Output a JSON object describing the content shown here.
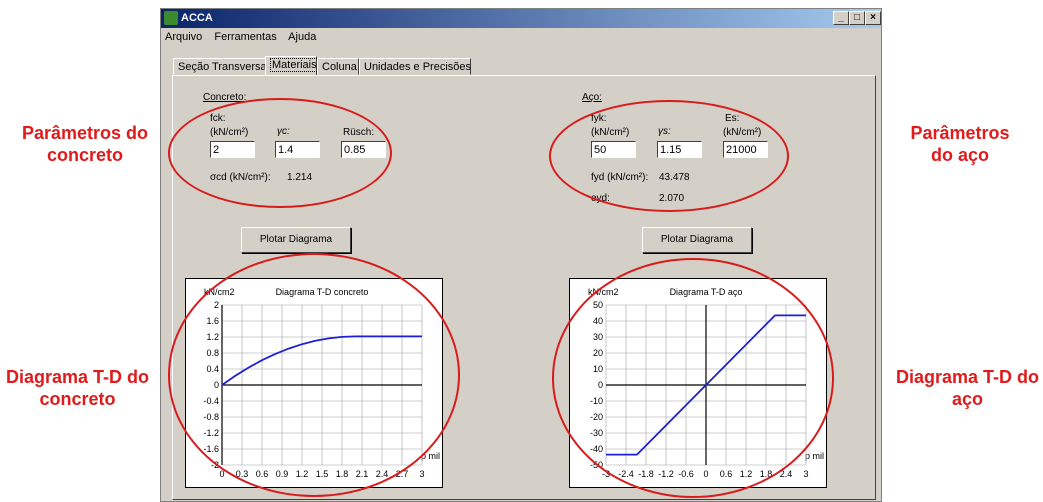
{
  "window": {
    "title": "ACCA"
  },
  "menu": [
    "Arquivo",
    "Ferramentas",
    "Ajuda"
  ],
  "tabs": [
    "Seção Transversal",
    "Materiais",
    "Coluna",
    "Unidades e Precisões"
  ],
  "active_tab": "Materiais",
  "concrete": {
    "section_label": "Concreto:",
    "fck_label": "fck:",
    "fck_unit": "(kN/cm²)",
    "fck_value": "2",
    "gamma_label": "γc:",
    "gamma_value": "1.4",
    "rusch_label": "Rüsch:",
    "rusch_value": "0.85",
    "sigma_label": "σcd (kN/cm²):",
    "sigma_value": "1.214",
    "plot_button": "Plotar Diagrama"
  },
  "steel": {
    "section_label": "Aço:",
    "fyk_label": "fyk:",
    "fyk_unit": "(kN/cm²)",
    "fyk_value": "50",
    "gamma_label": "γs:",
    "gamma_value": "1.15",
    "es_label": "Es:",
    "es_unit": "(kN/cm²)",
    "es_value": "21000",
    "fyd_label": "fyd (kN/cm²):",
    "fyd_value": "43.478",
    "eyd_label": "eyd:",
    "eyd_value": "2.070",
    "plot_button": "Plotar Diagrama"
  },
  "annotations": {
    "concrete_params": "Parâmetros do concreto",
    "steel_params": "Parâmetros do aço",
    "concrete_diagram": "Diagrama T-D do concreto",
    "steel_diagram": "Diagrama T-D do aço"
  },
  "colors": {
    "annotation": "#e01b1b",
    "curve": "#1f1fd6",
    "title_bar": "#0a246a"
  },
  "chart_data": [
    {
      "type": "line",
      "title": "Diagrama T-D concreto",
      "ylabel": "kN/cm2",
      "xlabel": "p mil",
      "xlim": [
        0,
        3
      ],
      "ylim": [
        -2,
        2
      ],
      "xticks": [
        "0",
        "0.3",
        "0.6",
        "0.9",
        "1.2",
        "1.5",
        "1.8",
        "2.1",
        "2.4",
        "2.7",
        "3"
      ],
      "yticks": [
        "2",
        "1.6",
        "1.2",
        "0.8",
        "0.4",
        "0",
        "-0.4",
        "-0.8",
        "-1.2",
        "-1.6",
        "-2"
      ],
      "grid": true,
      "series": [
        {
          "x": [
            0,
            0.2,
            0.4,
            0.6,
            0.8,
            1.0,
            1.2,
            1.4,
            1.6,
            1.8,
            2.0,
            2.2,
            2.4,
            2.6,
            2.8,
            3.0
          ],
          "y": [
            0,
            0.231,
            0.437,
            0.619,
            0.777,
            0.911,
            1.02,
            1.105,
            1.166,
            1.202,
            1.214,
            1.214,
            1.214,
            1.214,
            1.214,
            1.214
          ]
        }
      ]
    },
    {
      "type": "line",
      "title": "Diagrama T-D aço",
      "ylabel": "kN/cm2",
      "xlabel": "p mil",
      "xlim": [
        -3,
        3
      ],
      "ylim": [
        -50,
        50
      ],
      "xticks": [
        "-3",
        "-2.4",
        "-1.8",
        "-1.2",
        "-0.6",
        "0",
        "0.6",
        "1.2",
        "1.8",
        "2.4",
        "3"
      ],
      "yticks": [
        "50",
        "40",
        "30",
        "20",
        "10",
        "0",
        "-10",
        "-20",
        "-30",
        "-40",
        "-50"
      ],
      "grid": true,
      "series": [
        {
          "x": [
            -3,
            -2.07,
            2.07,
            3
          ],
          "y": [
            -43.478,
            -43.478,
            43.478,
            43.478
          ]
        }
      ]
    }
  ]
}
